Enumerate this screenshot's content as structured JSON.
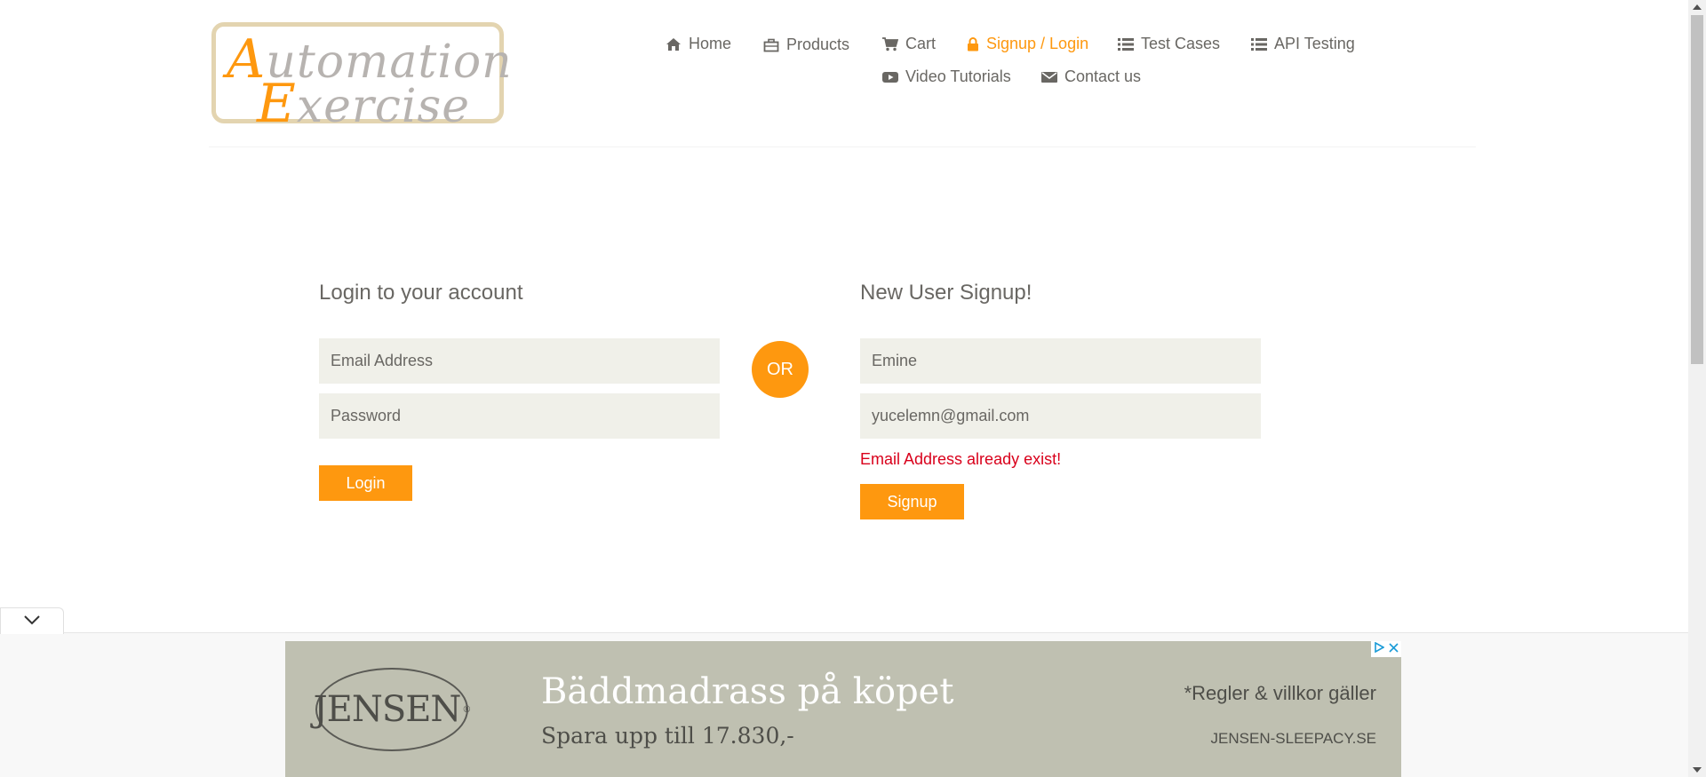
{
  "logo": {
    "line1_cap": "A",
    "line1_rest": "utomation",
    "line2_cap": "E",
    "line2_rest": "xercise"
  },
  "nav": {
    "home": "Home",
    "products": "Products",
    "cart": "Cart",
    "signup_login": "Signup / Login",
    "test_cases": "Test Cases",
    "api_testing": "API Testing",
    "video_tutorials": "Video Tutorials",
    "contact_us": "Contact us"
  },
  "login": {
    "title": "Login to your account",
    "email_placeholder": "Email Address",
    "password_placeholder": "Password",
    "button": "Login"
  },
  "or_label": "OR",
  "signup": {
    "title": "New User Signup!",
    "name_value": "Emine",
    "email_value": "yucelemn@gmail.com",
    "error": "Email Address already exist!",
    "button": "Signup"
  },
  "ad": {
    "brand": "JENSEN",
    "headline": "Bäddmadrass på köpet",
    "subline": "Spara upp till 17.830,-",
    "terms": "*Regler & villkor gäller",
    "site": "JENSEN-SLEEPACY.SE"
  },
  "colors": {
    "accent": "#fe980f",
    "text": "#696763",
    "input_bg": "#f0f0e9",
    "error": "#d9001b"
  }
}
